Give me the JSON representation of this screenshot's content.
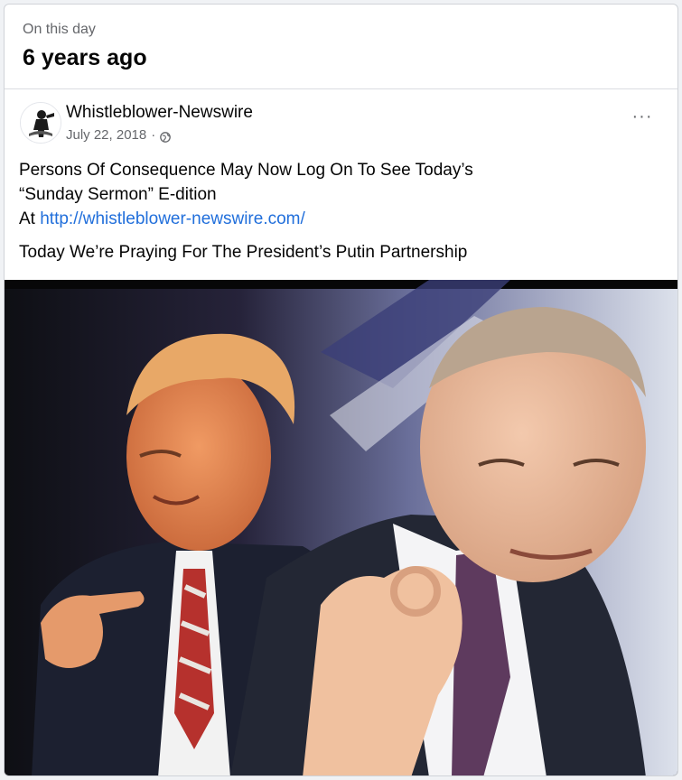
{
  "memory": {
    "kicker": "On this day",
    "title": "6 years ago"
  },
  "post": {
    "author": "Whistleblower-Newswire",
    "date": "July 22, 2018",
    "separator": "·",
    "visibility_icon": "globe-icon",
    "more_icon": "more-options-icon",
    "more_label": "···",
    "line1": "Persons Of Consequence May Now Log On To See Today’s",
    "line2": "“Sunday Sermon” E-dition",
    "line3_prefix": "At ",
    "link": "http://whistleblower-newswire.com/",
    "line4": "Today We’re Praying For The President’s Putin Partnership"
  },
  "image": {
    "subject": "photo of two men in suits, one pointing and one making an OK hand gesture"
  },
  "colors": {
    "link": "#216fdb",
    "secondary_text": "#65676b",
    "primary_text": "#050505",
    "page_background": "#f0f2f5"
  }
}
